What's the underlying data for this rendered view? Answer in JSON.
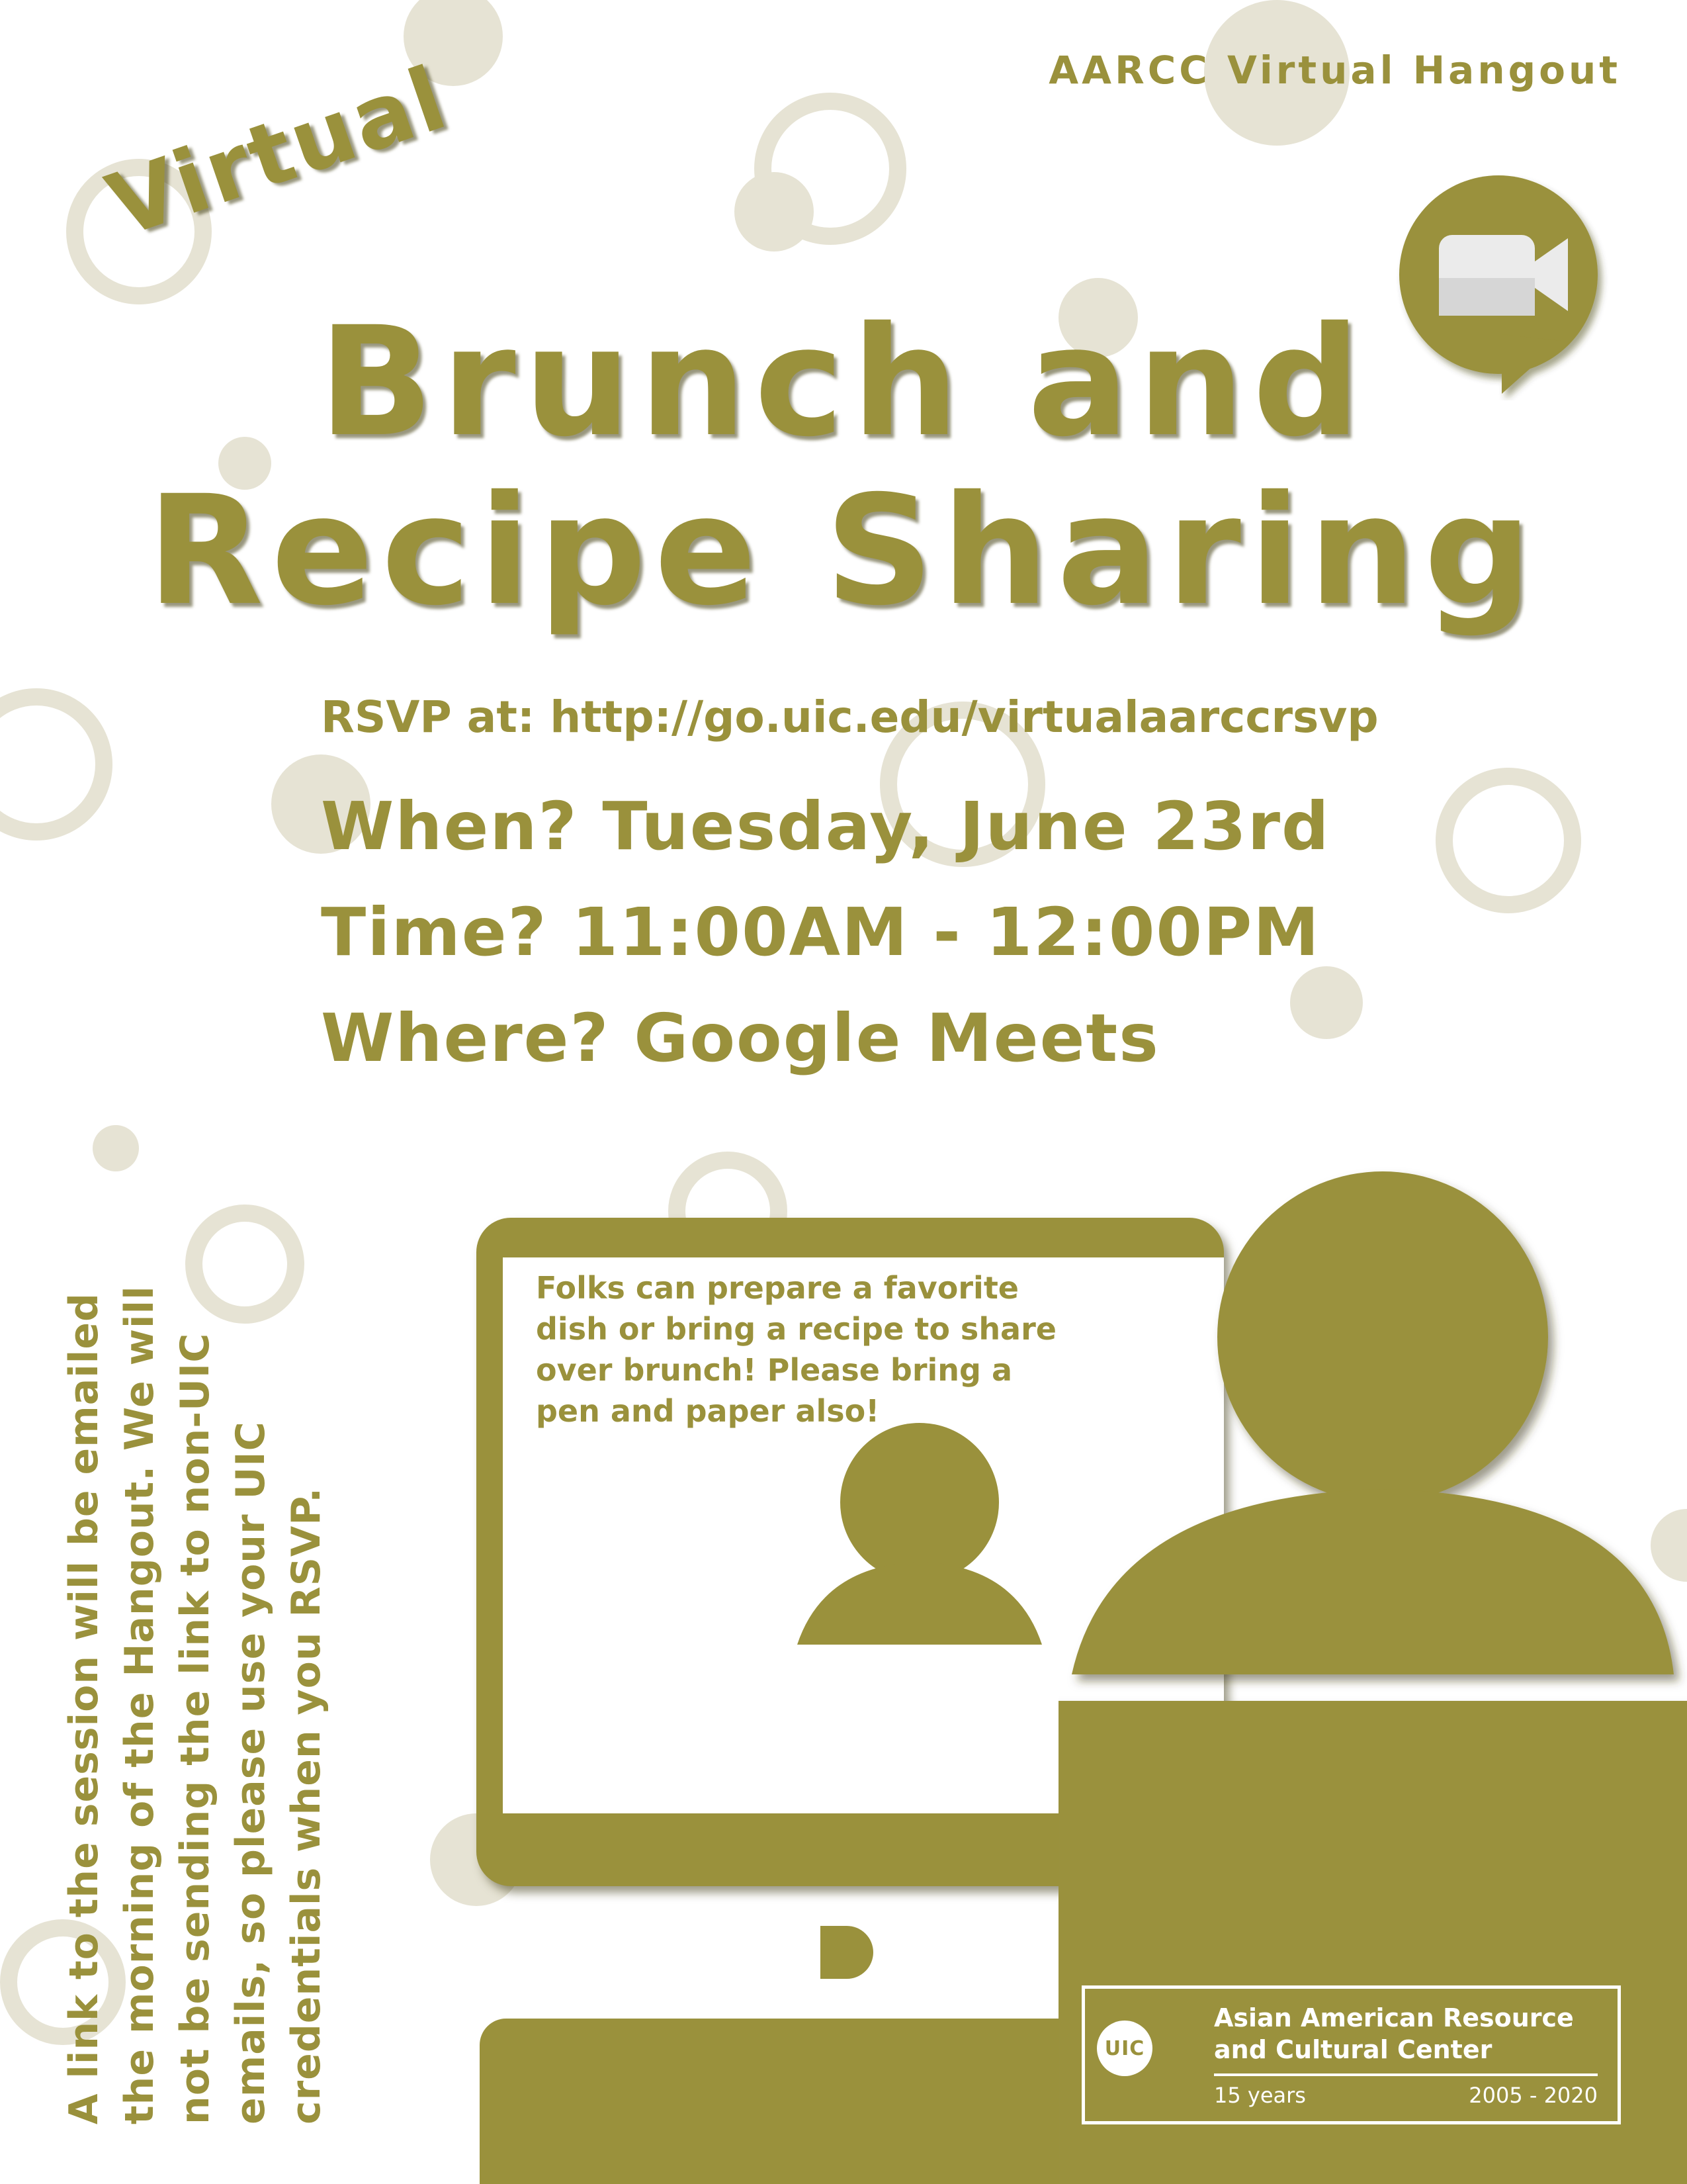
{
  "header": {
    "label": "AARCC Virtual Hangout"
  },
  "title": {
    "prefix": "Virtual",
    "line1": "Brunch and",
    "line2": "Recipe Sharing"
  },
  "rsvp": "RSVP at: http://go.uic.edu/virtualaarccrsvp",
  "details": {
    "when": "When? Tuesday, June 23rd",
    "time": "Time? 11:00AM - 12:00PM",
    "where": "Where? Google Meets"
  },
  "side_note": "A link to the session will be emailed the morning of the Hangout. We will not be sending the link to non-UIC emails, so please use your UIC credentials when you RSVP.",
  "screen_note": "Folks can prepare a favorite dish or bring a recipe to share over brunch! Please bring a pen and paper also!",
  "logo": {
    "badge": "UIC",
    "line1": "Asian American Resource",
    "line2": "and Cultural Center",
    "years_label": "15 years",
    "years_range": "2005 - 2020"
  },
  "colors": {
    "accent": "#9a913c",
    "bubble": "#e6e3d4",
    "background": "#ffffff"
  },
  "icons": [
    "video-camera-icon",
    "person-icon"
  ]
}
